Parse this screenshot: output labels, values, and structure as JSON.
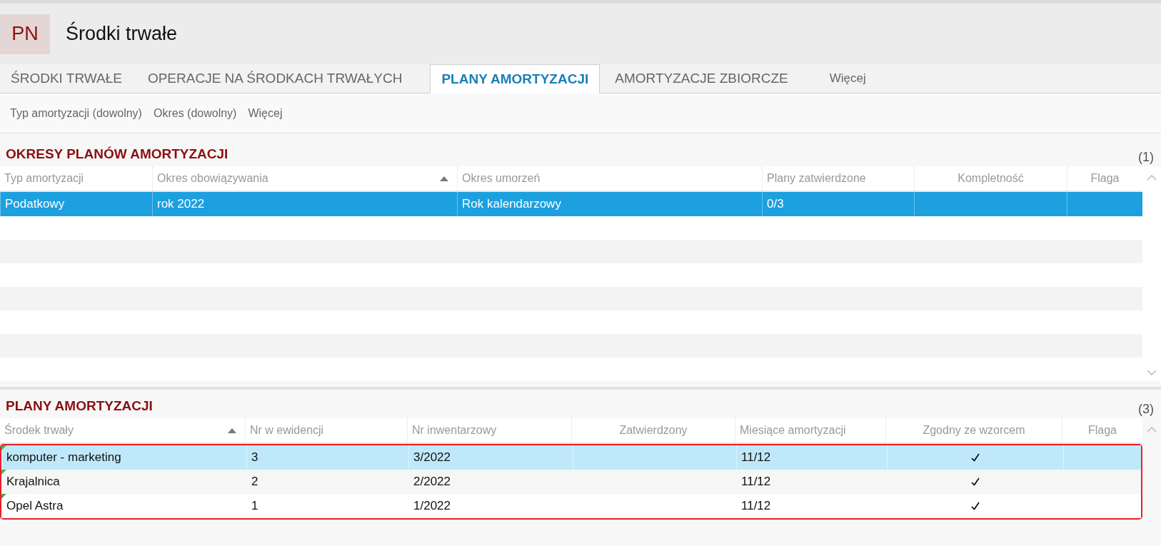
{
  "header": {
    "badge": "PN",
    "title": "Środki trwałe"
  },
  "tabs": [
    {
      "label": "ŚRODKI TRWAŁE",
      "selected": false
    },
    {
      "label": "OPERACJE NA ŚRODKACH TRWAŁYCH",
      "selected": false
    },
    {
      "label": "PLANY AMORTYZACJI",
      "selected": true
    },
    {
      "label": "AMORTYZACJE ZBIORCZE",
      "selected": false
    }
  ],
  "more_tab": "Więcej",
  "filters": [
    "Typ amortyzacji (dowolny)",
    "Okres (dowolny)",
    "Więcej"
  ],
  "sections": [
    {
      "title": "OKRESY PLANÓW AMORTYZACJI",
      "count": "(1)",
      "columns": [
        {
          "label": "Typ amortyzacji",
          "kind": "text",
          "sorted": false
        },
        {
          "label": "Okres obowiązywania",
          "kind": "text",
          "sorted": true
        },
        {
          "label": "Okres umorzeń",
          "kind": "text",
          "sorted": false
        },
        {
          "label": "Plany zatwierdzone",
          "kind": "text",
          "sorted": false
        },
        {
          "label": "Kompletność",
          "kind": "center",
          "sorted": false
        },
        {
          "label": "Flaga",
          "kind": "center",
          "sorted": false
        }
      ],
      "rows": [
        {
          "selected": true,
          "marker": false,
          "cells": [
            "Podatkowy",
            "rok 2022",
            "Rok kalendarzowy",
            "0/3",
            "",
            ""
          ]
        }
      ]
    },
    {
      "title": "PLANY AMORTYZACJI",
      "count": "(3)",
      "highlighted": true,
      "columns": [
        {
          "label": "Środek trwały",
          "kind": "text",
          "sorted": true
        },
        {
          "label": "Nr w ewidencji",
          "kind": "text",
          "sorted": false
        },
        {
          "label": "Nr inwentarzowy",
          "kind": "text",
          "sorted": false
        },
        {
          "label": "Zatwierdzony",
          "kind": "center",
          "sorted": false
        },
        {
          "label": "Miesiące amortyzacji",
          "kind": "text",
          "sorted": false
        },
        {
          "label": "Zgodny ze wzorcem",
          "kind": "check",
          "sorted": false
        },
        {
          "label": "Flaga",
          "kind": "center",
          "sorted": false
        }
      ],
      "rows": [
        {
          "selected": true,
          "marker": true,
          "cells": [
            "komputer - marketing",
            "3",
            "3/2022",
            "",
            "11/12",
            true,
            ""
          ]
        },
        {
          "selected": false,
          "marker": true,
          "cells": [
            "Krajalnica",
            "2",
            "2/2022",
            "",
            "11/12",
            true,
            ""
          ]
        },
        {
          "selected": false,
          "marker": true,
          "cells": [
            "Opel Astra",
            "1",
            "1/2022",
            "",
            "11/12",
            true,
            ""
          ]
        }
      ]
    }
  ]
}
